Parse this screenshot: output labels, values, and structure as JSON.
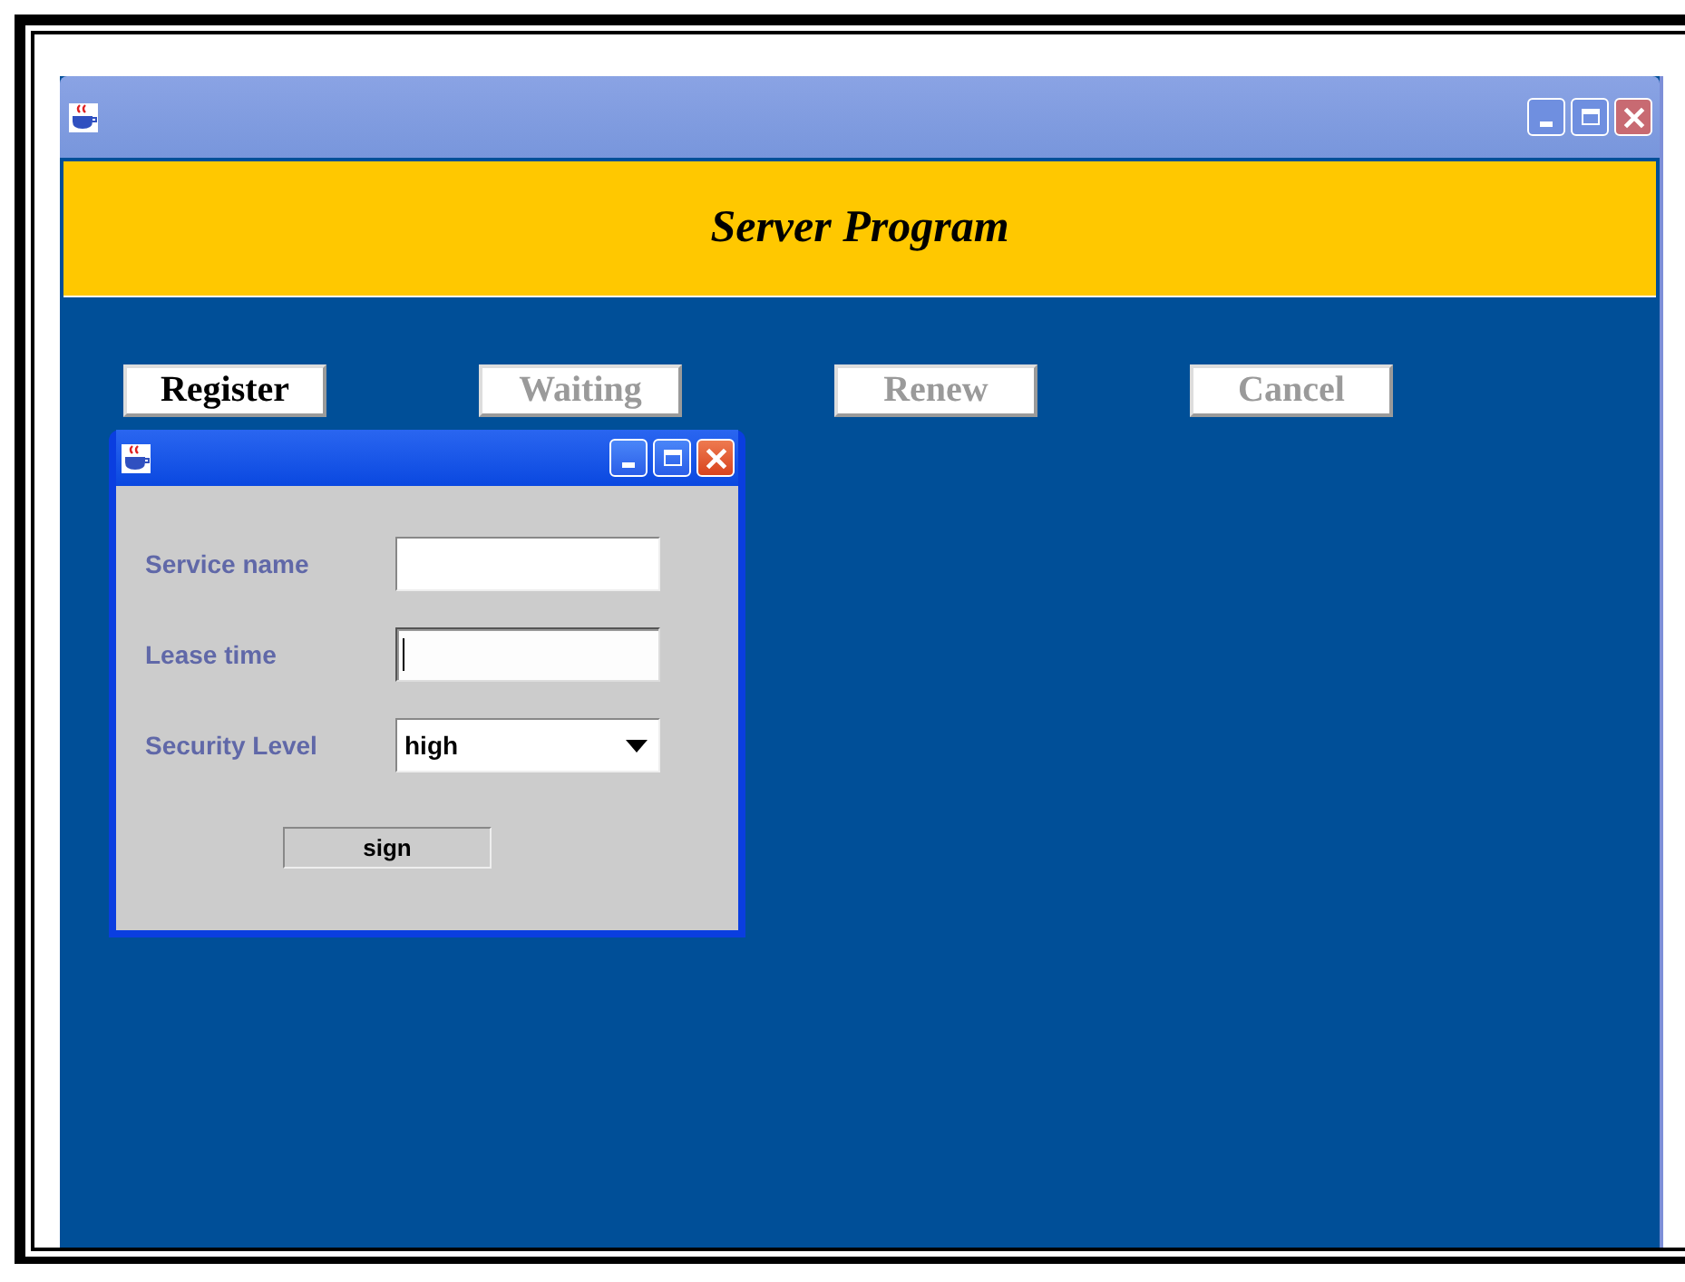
{
  "window": {
    "header": "Server Program"
  },
  "buttons": [
    {
      "label": "Register",
      "disabled": false
    },
    {
      "label": "Waiting",
      "disabled": true
    },
    {
      "label": "Renew",
      "disabled": true
    },
    {
      "label": "Cancel",
      "disabled": true
    }
  ],
  "dialog": {
    "fields": [
      {
        "kind": "text",
        "label": "Service name",
        "focused": false
      },
      {
        "kind": "text",
        "label": "Lease time",
        "focused": true
      },
      {
        "kind": "select",
        "label": "Security Level",
        "value": "high"
      }
    ],
    "button": "sign"
  }
}
